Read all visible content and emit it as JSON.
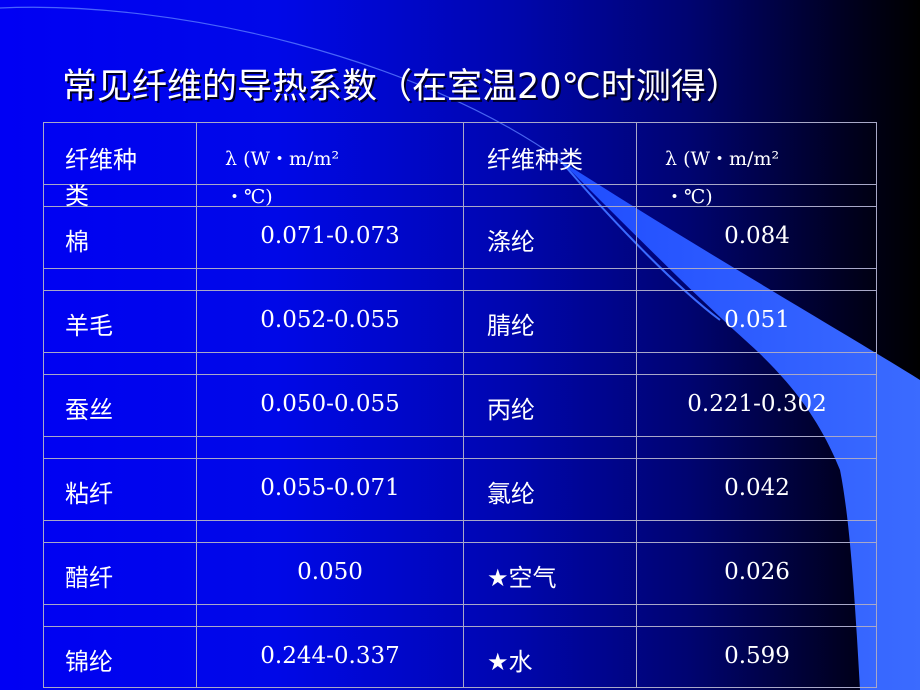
{
  "slide": {
    "title": "常见纤维的导热系数（在室温20℃时测得）",
    "colors": {
      "background_left": "#0000f4",
      "background_right": "#000000",
      "swoosh": "#3366ff",
      "grid_line": "#a8a8c8",
      "text": "#ffffff"
    }
  },
  "table": {
    "headers": [
      {
        "line1": "纤维种",
        "line2": "类"
      },
      {
        "line1": "λ (W・m/m²",
        "line2": "・℃)"
      },
      {
        "line1": "纤维种类",
        "line2": ""
      },
      {
        "line1": "λ (W・m/m²",
        "line2": "・℃)"
      }
    ],
    "rows": [
      {
        "fiber_a": "棉",
        "value_a": "0.071-0.073",
        "fiber_b": "涤纶",
        "value_b": "0.084"
      },
      {
        "fiber_a": "羊毛",
        "value_a": "0.052-0.055",
        "fiber_b": "腈纶",
        "value_b": "0.051"
      },
      {
        "fiber_a": "蚕丝",
        "value_a": "0.050-0.055",
        "fiber_b": "丙纶",
        "value_b": "0.221-0.302"
      },
      {
        "fiber_a": "粘纤",
        "value_a": "0.055-0.071",
        "fiber_b": "氯纶",
        "value_b": "0.042"
      },
      {
        "fiber_a": "醋纤",
        "value_a": "0.050",
        "fiber_b": "★空气",
        "value_b": "0.026"
      },
      {
        "fiber_a": "锦纶",
        "value_a": "0.244-0.337",
        "fiber_b": "★水",
        "value_b": "0.599"
      }
    ]
  }
}
